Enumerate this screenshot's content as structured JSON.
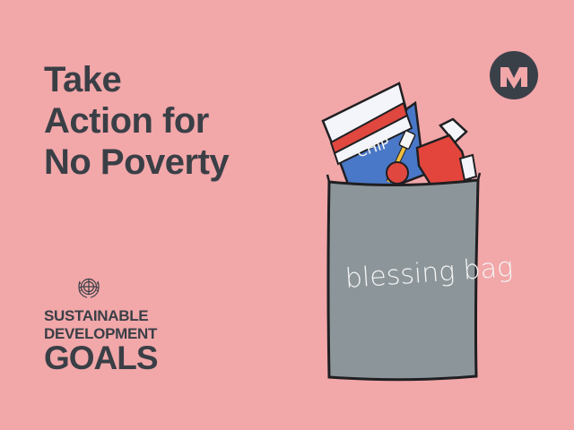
{
  "colors": {
    "background": "#f2a7a9",
    "text": "#3a3f46",
    "bag_gray": "#8c9599",
    "chip_blue": "#4a78c8",
    "chip_red": "#e0473f",
    "chip_white": "#f3f5fa",
    "bottle_red": "#e3453c",
    "logo_bg": "#3a4048",
    "logo_pink": "#f2a7a9",
    "outline": "#1f1f22"
  },
  "headline": {
    "line1": "Take",
    "line2": "Action for",
    "line3": "No Poverty"
  },
  "sdg": {
    "line1": "SUSTAINABLE",
    "line2": "DEVELOPMENT",
    "line3": "GOALS",
    "emblem": "un-emblem-icon"
  },
  "logo": {
    "icon": "m-logo-icon",
    "letter": "M"
  },
  "illustration": {
    "bag_label": "blessing bag",
    "chips_label": "CHIP"
  }
}
